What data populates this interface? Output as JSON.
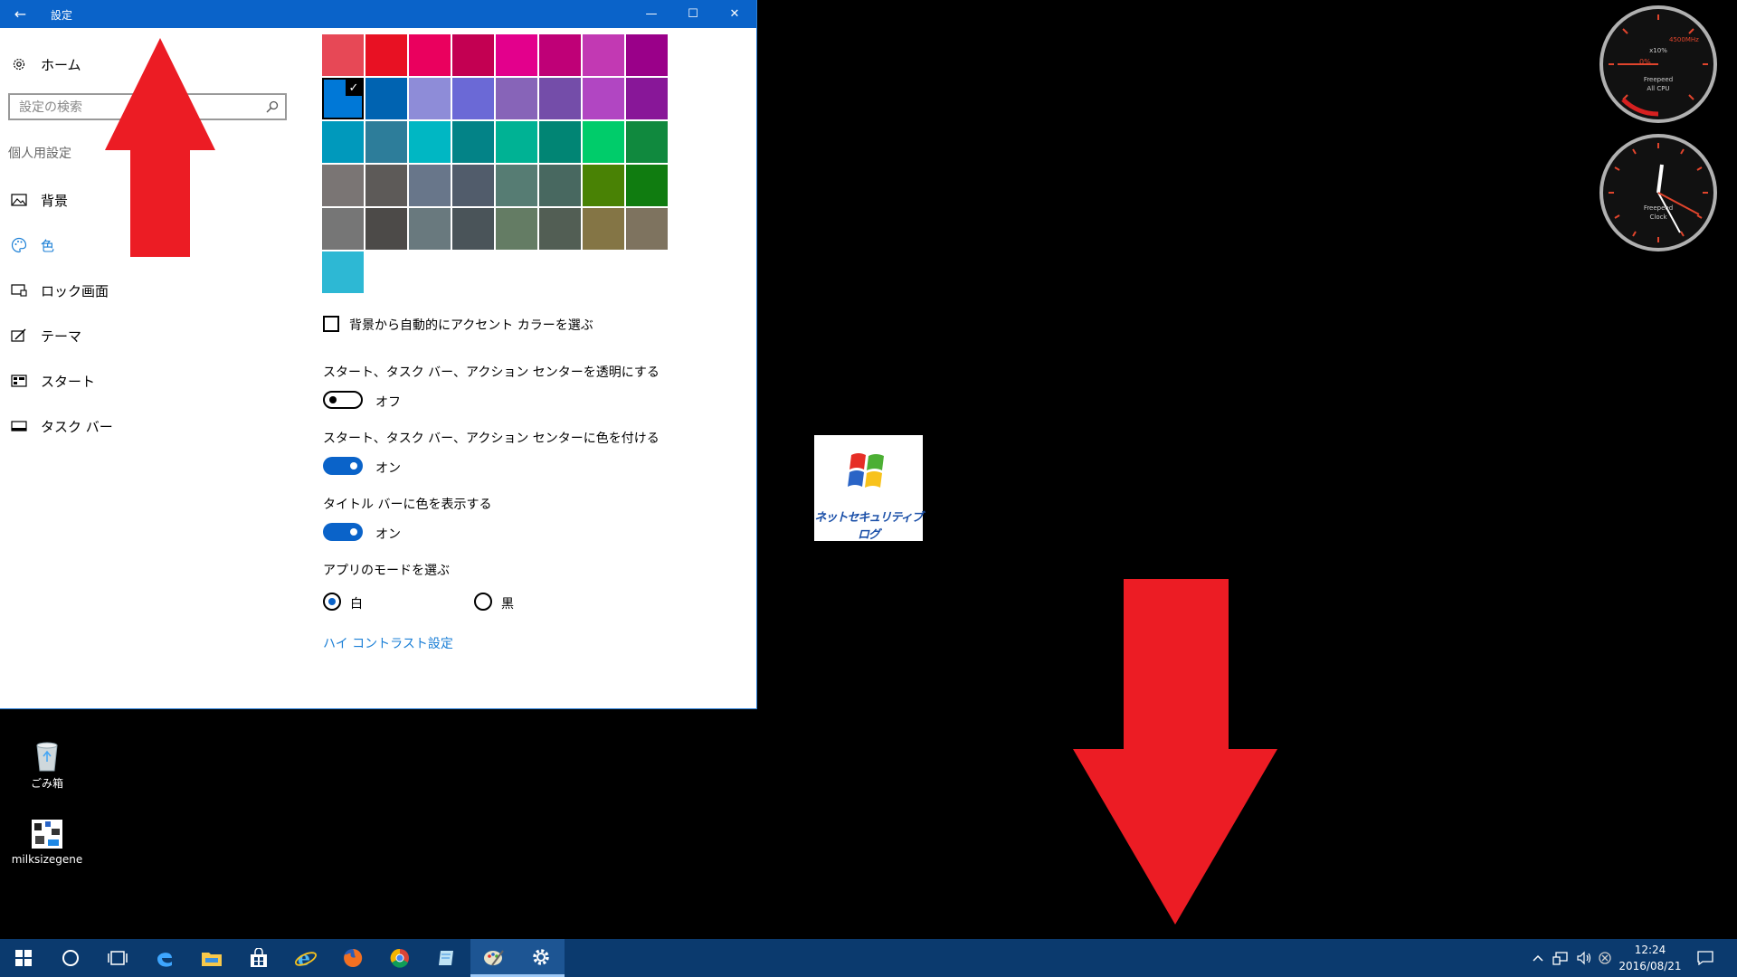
{
  "window": {
    "title": "設定",
    "back_glyph": "←",
    "min_glyph": "—",
    "max_glyph": "☐",
    "close_glyph": "✕"
  },
  "sidebar": {
    "home_label": "ホーム",
    "search_placeholder": "設定の検索",
    "section_label": "個人用設定",
    "items": [
      {
        "label": "背景",
        "icon": "picture-icon"
      },
      {
        "label": "色",
        "icon": "palette-icon",
        "selected": true
      },
      {
        "label": "ロック画面",
        "icon": "lock-screen-icon"
      },
      {
        "label": "テーマ",
        "icon": "theme-icon"
      },
      {
        "label": "スタート",
        "icon": "start-icon"
      },
      {
        "label": "タスク バー",
        "icon": "taskbar-icon"
      }
    ]
  },
  "colors": {
    "rows": [
      [
        "#e74856",
        "#e81123",
        "#ea005e",
        "#c30052",
        "#e3008c",
        "#bf0077",
        "#c239b3",
        "#9a0089"
      ],
      [
        "#0078d7",
        "#0063b1",
        "#8e8cd8",
        "#6b69d6",
        "#8764b8",
        "#744da9",
        "#b146c2",
        "#881798"
      ],
      [
        "#0099bc",
        "#2d7d9a",
        "#00b7c3",
        "#038387",
        "#00b294",
        "#018574",
        "#00cc6a",
        "#10893e"
      ],
      [
        "#7a7574",
        "#5d5a58",
        "#68768a",
        "#515c6b",
        "#567c73",
        "#486860",
        "#498205",
        "#107c10"
      ],
      [
        "#767676",
        "#4c4a48",
        "#69797e",
        "#4a5459",
        "#647c64",
        "#525e54",
        "#847545",
        "#7e735f"
      ],
      [
        "#2db8d4"
      ]
    ],
    "selected": "#0078d7",
    "accent": "#0a63c9"
  },
  "settings": {
    "auto_accent_label": "背景から自動的にアクセント カラーを選ぶ",
    "auto_accent_checked": false,
    "transparency_label": "スタート、タスク バー、アクション センターを透明にする",
    "transparency_state": "オフ",
    "color_start_label": "スタート、タスク バー、アクション センターに色を付ける",
    "color_start_state": "オン",
    "titlebar_label": "タイトル バーに色を表示する",
    "titlebar_state": "オン",
    "app_mode_label": "アプリのモードを選ぶ",
    "mode_light": "白",
    "mode_dark": "黒",
    "mode_selected": "白",
    "high_contrast_link": "ハイ コントラスト設定"
  },
  "desktop": {
    "recycle_bin_label": "ごみ箱",
    "milk_label": "milksizegene",
    "logo_text": "ネットセキュリティブログ"
  },
  "gauges": {
    "cpu": {
      "brand": "Freepeed",
      "name": "All CPU",
      "percent_text": "0%",
      "freq_text": "4500MHz",
      "multiplier_text": "x10%"
    },
    "clock": {
      "brand": "Freepeed",
      "name": "Clock"
    }
  },
  "taskbar": {
    "time": "12:24",
    "date": "2016/08/21",
    "apps": [
      "windows-start-icon",
      "cortana-icon",
      "task-view-icon",
      "edge-icon",
      "file-explorer-icon",
      "store-icon",
      "ie-icon",
      "firefox-icon",
      "chrome-icon",
      "notepad-icon",
      "paint-icon",
      "settings-gear-icon"
    ]
  }
}
